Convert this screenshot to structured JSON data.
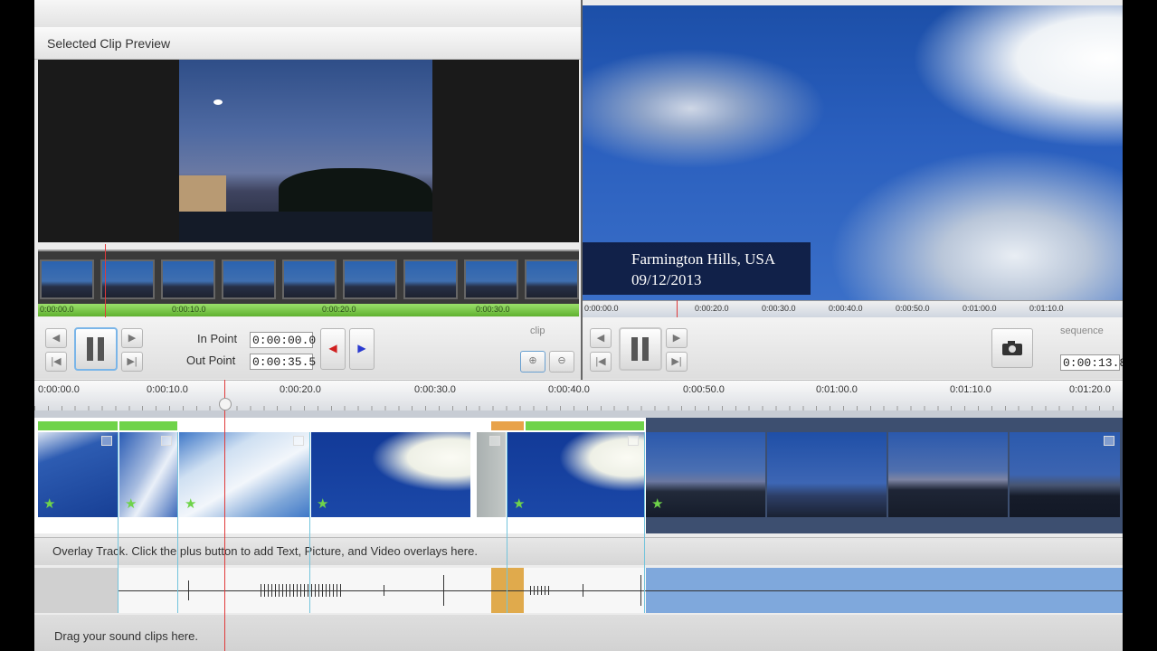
{
  "clip_panel": {
    "title": "Selected Clip Preview",
    "ruler_labels": [
      "0:00:00.0",
      "0:00:10.0",
      "0:00:20.0",
      "0:00:30.0"
    ],
    "in_point_label": "In Point",
    "in_point_value": "0:00:00.0",
    "out_point_label": "Out Point",
    "out_point_value": "0:00:35.5",
    "mode_label": "clip"
  },
  "sequence_panel": {
    "caption_line1": "Farmington Hills, USA",
    "caption_line2": "09/12/2013",
    "ruler_labels": [
      "0:00:00.0",
      "0:00:20.0",
      "0:00:30.0",
      "0:00:40.0",
      "0:00:50.0",
      "0:01:00.0",
      "0:01:10.0"
    ],
    "mode_label": "sequence",
    "time_value": "0:00:13.8"
  },
  "timeline": {
    "ruler_labels": [
      "0:00:00.0",
      "0:00:10.0",
      "0:00:20.0",
      "0:00:30.0",
      "0:00:40.0",
      "0:00:50.0",
      "0:01:00.0",
      "0:01:10.0",
      "0:01:20.0"
    ],
    "overlay_hint": "Overlay Track. Click the plus button to add Text, Picture, and Video overlays here.",
    "sound_hint": "Drag your sound clips here."
  },
  "icons": {
    "star": "★",
    "prev_frame": "◀",
    "next_frame": "▶",
    "go_start": "|◀",
    "go_end": "▶|",
    "zoom_in": "⊕",
    "zoom_out": "⊖"
  },
  "colors": {
    "accent_green": "#6fd34a",
    "playhead_red": "#e03a3a",
    "selection_blue": "#73c4dc"
  }
}
